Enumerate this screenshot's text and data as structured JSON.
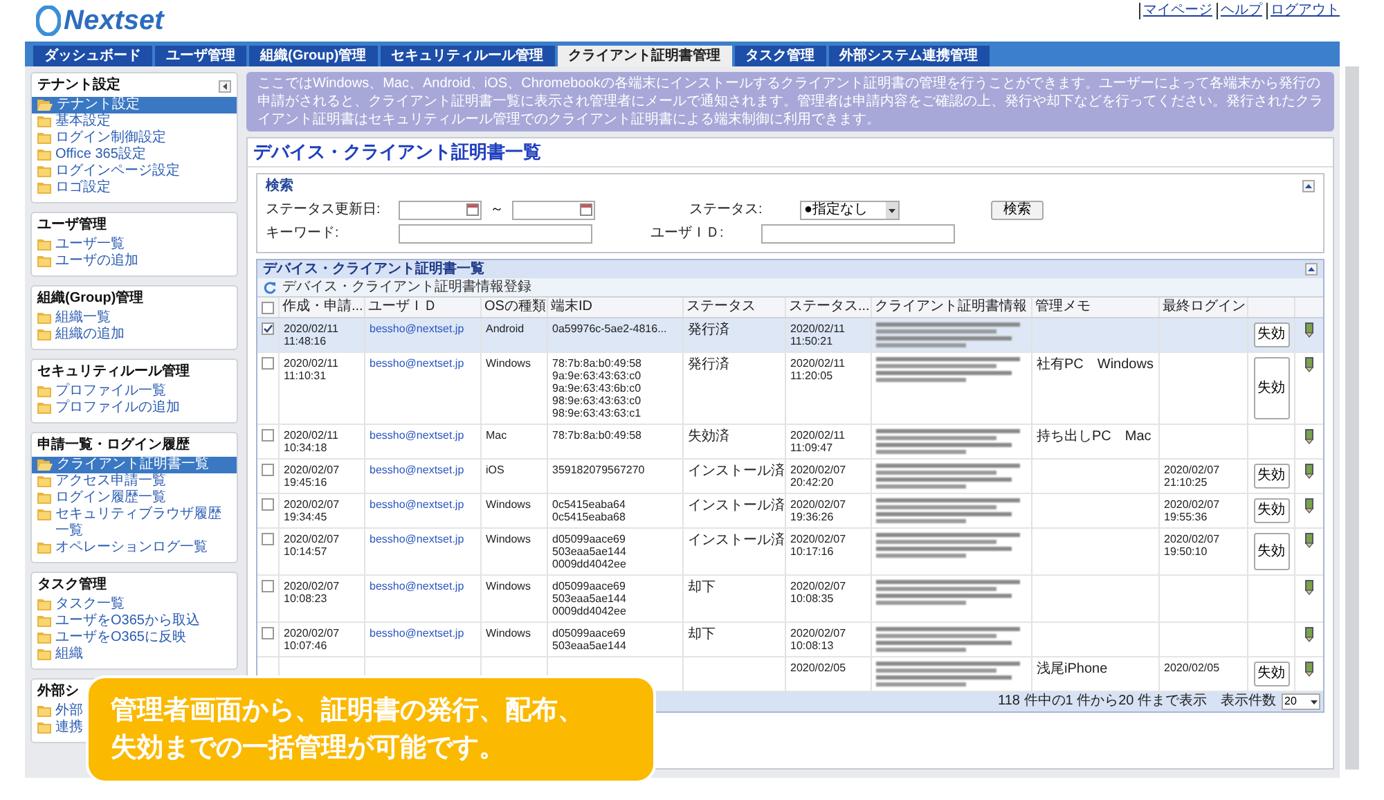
{
  "header": {
    "logo": "Nextset",
    "links": [
      "マイページ",
      "ヘルプ",
      "ログアウト"
    ]
  },
  "nav_tabs": [
    {
      "label": "ダッシュボード",
      "selected": false
    },
    {
      "label": "ユーザ管理",
      "selected": false
    },
    {
      "label": "組織(Group)管理",
      "selected": false
    },
    {
      "label": "セキュリティルール管理",
      "selected": false
    },
    {
      "label": "クライアント証明書管理",
      "selected": true
    },
    {
      "label": "タスク管理",
      "selected": false
    },
    {
      "label": "外部システム連携管理",
      "selected": false
    }
  ],
  "sidebar": [
    {
      "title": "テナント設定",
      "collapsible": true,
      "items": [
        {
          "text": "テナント設定",
          "selected": true
        },
        {
          "text": "基本設定",
          "selected": false
        },
        {
          "text": "ログイン制御設定",
          "selected": false
        },
        {
          "text": "Office 365設定",
          "selected": false
        },
        {
          "text": "ログインページ設定",
          "selected": false
        },
        {
          "text": "ロゴ設定",
          "selected": false
        }
      ]
    },
    {
      "title": "ユーザ管理",
      "collapsible": false,
      "items": [
        {
          "text": "ユーザ一覧",
          "selected": false
        },
        {
          "text": "ユーザの追加",
          "selected": false
        }
      ]
    },
    {
      "title": "組織(Group)管理",
      "collapsible": false,
      "items": [
        {
          "text": "組織一覧",
          "selected": false
        },
        {
          "text": "組織の追加",
          "selected": false
        }
      ]
    },
    {
      "title": "セキュリティルール管理",
      "collapsible": false,
      "items": [
        {
          "text": "プロファイル一覧",
          "selected": false
        },
        {
          "text": "プロファイルの追加",
          "selected": false
        }
      ]
    },
    {
      "title": "申請一覧・ログイン履歴",
      "collapsible": false,
      "items": [
        {
          "text": "クライアント証明書一覧",
          "selected": true
        },
        {
          "text": "アクセス申請一覧",
          "selected": false
        },
        {
          "text": "ログイン履歴一覧",
          "selected": false
        },
        {
          "text": "セキュリティブラウザ履歴一覧",
          "selected": false
        },
        {
          "text": "オペレーションログ一覧",
          "selected": false
        }
      ]
    },
    {
      "title": "タスク管理",
      "collapsible": false,
      "items": [
        {
          "text": "タスク一覧",
          "selected": false
        },
        {
          "text": "ユーザをO365から取込",
          "selected": false
        },
        {
          "text": "ユーザをO365に反映",
          "selected": false
        },
        {
          "text": "組織",
          "selected": false
        }
      ]
    },
    {
      "title": "外部シ",
      "items": [
        {
          "text": "外部",
          "selected": false
        },
        {
          "text": "連携",
          "selected": false
        }
      ]
    }
  ],
  "info": "ここではWindows、Mac、Android、iOS、Chromebookの各端末にインストールするクライアント証明書の管理を行うことができます。ユーザーによって各端末から発行の申請がされると、クライアント証明書一覧に表示され管理者にメールで通知されます。管理者は申請内容をご確認の上、発行や却下などを行ってください。発行されたクライアント証明書はセキュリティルール管理でのクライアント証明書による端末制御に利用できます。",
  "page_title": "デバイス・クライアント証明書一覧",
  "search": {
    "title": "検索",
    "date_label": "ステータス更新日:",
    "range_separator": "～",
    "status_label": "ステータス:",
    "status_value": "●指定なし",
    "button": "検索",
    "keyword_label": "キーワード:",
    "user_id_label": "ユーザＩＤ:"
  },
  "grid": {
    "title": "デバイス・クライアント証明書一覧",
    "toolbar_button": "デバイス・クライアント証明書情報登録",
    "header_checked": false,
    "columns": [
      "作成・申請...",
      "ユーザＩＤ",
      "OSの種類",
      "端末ID",
      "ステータス",
      "ステータス...",
      "クライアント証明書情報",
      "管理メモ",
      "最終ログイン"
    ],
    "rows": [
      {
        "checked": true,
        "created": [
          "2020/02/11",
          "11:48:16"
        ],
        "user": "bessho@nextset.jp",
        "os": "Android",
        "terminal_id": [
          "0a59976c-5ae2-4816..."
        ],
        "status": "発行済",
        "status_date": [
          "2020/02/11",
          "11:50:21"
        ],
        "action": "失効"
      },
      {
        "checked": false,
        "created": [
          "2020/02/11",
          "11:10:31"
        ],
        "user": "bessho@nextset.jp",
        "os": "Windows",
        "terminal_id": [
          "78:7b:8a:b0:49:58",
          "9a:9e:63:43:63:c0",
          "9a:9e:63:43:6b:c0",
          "98:9e:63:43:63:c0",
          "98:9e:63:43:63:c1"
        ],
        "status": "発行済",
        "status_date": [
          "2020/02/11",
          "11:20:05"
        ],
        "memo": "社有PC　Windows",
        "action": "失効"
      },
      {
        "checked": false,
        "created": [
          "2020/02/11",
          "10:34:18"
        ],
        "user": "bessho@nextset.jp",
        "os": "Mac",
        "terminal_id": [
          "78:7b:8a:b0:49:58"
        ],
        "status": "失効済",
        "status_date": [
          "2020/02/11",
          "11:09:47"
        ],
        "memo": "持ち出しPC　Mac"
      },
      {
        "checked": false,
        "created": [
          "2020/02/07",
          "19:45:16"
        ],
        "user": "bessho@nextset.jp",
        "os": "iOS",
        "terminal_id": [
          "359182079567270"
        ],
        "status": "インストール済",
        "status_date": [
          "2020/02/07",
          "20:42:20"
        ],
        "last_login": [
          "2020/02/07",
          "21:10:25"
        ],
        "action": "失効"
      },
      {
        "checked": false,
        "created": [
          "2020/02/07",
          "19:34:45"
        ],
        "user": "bessho@nextset.jp",
        "os": "Windows",
        "terminal_id": [
          "0c5415eaba64",
          "0c5415eaba68"
        ],
        "status": "インストール済",
        "status_date": [
          "2020/02/07",
          "19:36:26"
        ],
        "last_login": [
          "2020/02/07",
          "19:55:36"
        ],
        "action": "失効"
      },
      {
        "checked": false,
        "created": [
          "2020/02/07",
          "10:14:57"
        ],
        "user": "bessho@nextset.jp",
        "os": "Windows",
        "terminal_id": [
          "d05099aace69",
          "503eaa5ae144",
          "0009dd4042ee"
        ],
        "status": "インストール済",
        "status_date": [
          "2020/02/07",
          "10:17:16"
        ],
        "last_login": [
          "2020/02/07",
          "19:50:10"
        ],
        "action": "失効"
      },
      {
        "checked": false,
        "created": [
          "2020/02/07",
          "10:08:23"
        ],
        "user": "bessho@nextset.jp",
        "os": "Windows",
        "terminal_id": [
          "d05099aace69",
          "503eaa5ae144",
          "0009dd4042ee"
        ],
        "status": "却下",
        "status_date": [
          "2020/02/07",
          "10:08:35"
        ]
      },
      {
        "checked": false,
        "created": [
          "2020/02/07",
          "10:07:46"
        ],
        "user": "bessho@nextset.jp",
        "os": "Windows",
        "terminal_id": [
          "d05099aace69",
          "503eaa5ae144"
        ],
        "status": "却下",
        "status_date": [
          "2020/02/07",
          "10:08:13"
        ]
      },
      {
        "status_date": [
          "2020/02/05"
        ],
        "memo": "浅尾iPhone",
        "last_login": [
          "2020/02/05"
        ],
        "action": "失効"
      }
    ],
    "footer": {
      "summary": "118 件中の1 件から20 件まで表示",
      "page_size_label": "表示件数",
      "page_size": "20"
    }
  },
  "callout": [
    "管理者画面から、証明書の発行、配布、",
    "失効までの一括管理が可能です。"
  ]
}
